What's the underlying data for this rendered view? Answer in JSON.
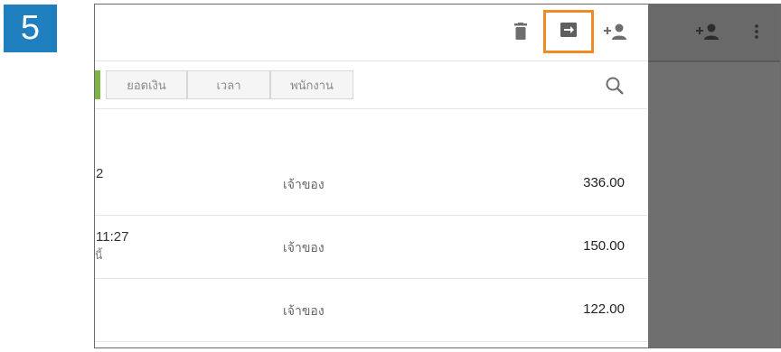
{
  "step": {
    "number": "5"
  },
  "toolbar": {
    "icons": [
      "trash-icon",
      "export-icon",
      "add-user-icon"
    ],
    "highlight_color": "#f08a24"
  },
  "filters": {
    "tabs": [
      "ยอดเงิน",
      "เวลา",
      "พนักงาน"
    ],
    "active_color": "#7cb342",
    "search_icon": "search-icon"
  },
  "rows": [
    {
      "left": "2",
      "sub": "",
      "employee": "เจ้าของ",
      "amount": "336.00"
    },
    {
      "left": "11:27",
      "sub": "ันี้",
      "employee": "เจ้าของ",
      "amount": "150.00"
    },
    {
      "left": "",
      "sub": "",
      "employee": "เจ้าของ",
      "amount": "122.00"
    }
  ],
  "overlay": {
    "icons": [
      "add-user-icon",
      "more-vert-icon"
    ],
    "color": "#6f6f6f"
  }
}
